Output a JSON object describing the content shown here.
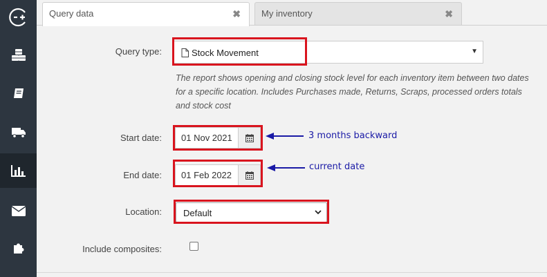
{
  "sidebar": {
    "items": [
      {
        "icon": "circle-plus-minus-icon"
      },
      {
        "icon": "cubes-icon"
      },
      {
        "icon": "book-icon"
      },
      {
        "icon": "truck-icon"
      },
      {
        "icon": "bar-chart-icon",
        "active": true
      },
      {
        "icon": "envelope-icon"
      },
      {
        "icon": "puzzle-icon"
      }
    ],
    "accent": "#2d3640"
  },
  "tabs": [
    {
      "label": "Query data",
      "close": "✖",
      "active": true
    },
    {
      "label": "My inventory",
      "close": "✖",
      "active": false
    }
  ],
  "form": {
    "query_type_label": "Query type:",
    "query_type_value": "Stock Movement",
    "description": "The report shows opening and closing stock level for each inventory item between two dates for a specific location. Includes Purchases made, Returns, Scraps, processed orders totals and stock cost",
    "start_date_label": "Start date:",
    "start_date_value": "01 Nov 2021",
    "end_date_label": "End date:",
    "end_date_value": "01 Feb 2022",
    "location_label": "Location:",
    "location_value": "Default",
    "include_composites_label": "Include composites:",
    "include_composites_checked": false
  },
  "annotations": {
    "start_note": "3 months backward",
    "end_note": "current date",
    "highlight_color": "#d9141e",
    "note_color": "#1a1aa6"
  }
}
